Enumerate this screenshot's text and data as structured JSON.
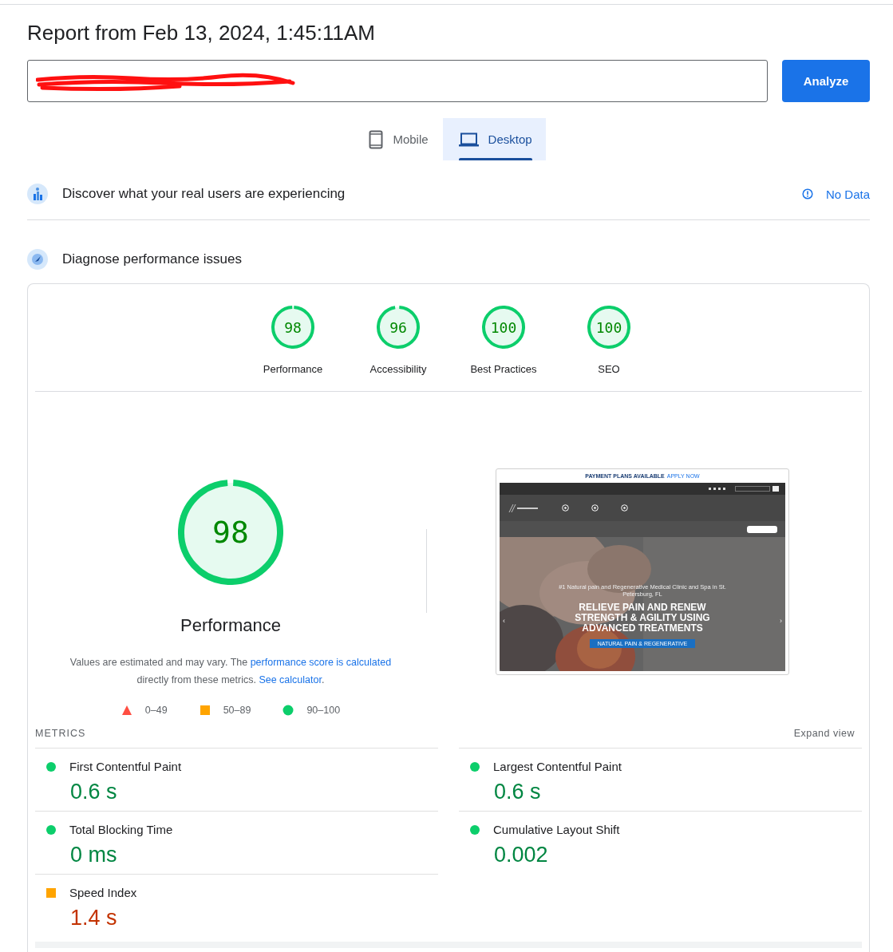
{
  "report_title": "Report from Feb 13, 2024, 1:45:11AM",
  "analyze_button": "Analyze",
  "device_tabs": [
    {
      "label": "Mobile",
      "kind": "phone",
      "selected": false
    },
    {
      "label": "Desktop",
      "kind": "laptop",
      "selected": true
    }
  ],
  "field_data": {
    "title": "Discover what your real users are experiencing",
    "status": "No Data"
  },
  "lab_data": {
    "title": "Diagnose performance issues"
  },
  "category_gauges": [
    {
      "score": "98",
      "label": "Performance",
      "level": 0.98
    },
    {
      "score": "96",
      "label": "Accessibility",
      "level": 0.96
    },
    {
      "score": "100",
      "label": "Best Practices",
      "level": 1
    },
    {
      "score": "100",
      "label": "SEO",
      "level": 1
    }
  ],
  "main_gauge": {
    "score": "98",
    "label": "Performance",
    "level": 0.98
  },
  "note": {
    "text_before": "Values are estimated and may vary. The ",
    "link": "performance score is calculated",
    "text_middle": " directly from these metrics. ",
    "link_2": "See calculator",
    "text_after": "."
  },
  "legend": [
    {
      "kind": "fail",
      "range": "0–49"
    },
    {
      "kind": "average",
      "range": "50–89"
    },
    {
      "kind": "pass",
      "range": "90–100"
    }
  ],
  "screenshot": {
    "banner": "PAYMENT PLANS AVAILABLE",
    "banner_link": "APPLY NOW",
    "prev_arrow": "‹",
    "next_arrow": "›",
    "subtitle": "#1 Natural pain and Regenerative Medical Clinic and Spa in St. Petersburg, FL",
    "headline": "RELIEVE PAIN AND RENEW STRENGTH & AGILITY USING ADVANCED TREATMENTS",
    "cta": "NATURAL PAIN & REGENERATIVE"
  },
  "metrics_heading": "METRICS",
  "expand_link": "Expand view",
  "metrics": [
    {
      "name": "First Contentful Paint",
      "value": "0.6 s",
      "kind": "pass"
    },
    {
      "name": "Largest Contentful Paint",
      "value": "0.6 s",
      "kind": "pass"
    },
    {
      "name": "Total Blocking Time",
      "value": "0 ms",
      "kind": "pass"
    },
    {
      "name": "Cumulative Layout Shift",
      "value": "0.002",
      "kind": "pass"
    },
    {
      "name": "Speed Index",
      "value": "1.4 s",
      "kind": "average"
    }
  ]
}
